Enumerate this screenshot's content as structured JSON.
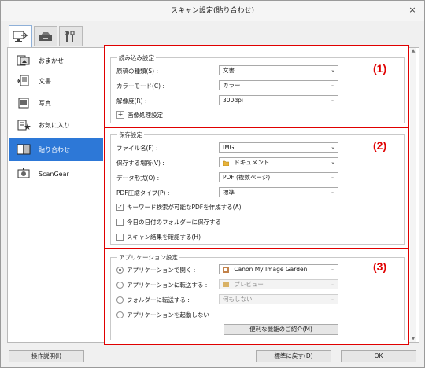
{
  "window": {
    "title": "スキャン設定(貼り合わせ)",
    "close_glyph": "×"
  },
  "tabs": [
    {
      "name": "scan-from-computer",
      "icon": "computer-scan-icon"
    },
    {
      "name": "scan-from-panel",
      "icon": "scanner-icon"
    },
    {
      "name": "general-settings",
      "icon": "tools-icon"
    }
  ],
  "sidebar": {
    "items": [
      {
        "label": "おまかせ",
        "icon": "auto-scan-icon"
      },
      {
        "label": "文書",
        "icon": "document-icon"
      },
      {
        "label": "写真",
        "icon": "photo-icon"
      },
      {
        "label": "お気に入り",
        "icon": "favorite-icon"
      },
      {
        "label": "貼り合わせ",
        "icon": "stitch-icon",
        "active": true
      },
      {
        "label": "ScanGear",
        "icon": "scangear-icon"
      }
    ]
  },
  "scan_options": {
    "title": "読み込み設定",
    "marker": "(1)",
    "source_label": "原稿の種類(S) :",
    "source_value": "文書",
    "color_mode_label": "カラーモード(C) :",
    "color_mode_value": "カラー",
    "resolution_label": "解像度(R) :",
    "resolution_value": "300dpi",
    "image_processing_label": "画像処理設定",
    "expand_glyph": "+"
  },
  "save_settings": {
    "title": "保存設定",
    "marker": "(2)",
    "file_name_label": "ファイル名(F) :",
    "file_name_value": "IMG",
    "save_in_label": "保存する場所(V) :",
    "save_in_value": "ドキュメント",
    "data_format_label": "データ形式(O) :",
    "data_format_value": "PDF (複数ページ)",
    "pdf_compression_label": "PDF圧縮タイプ(P) :",
    "pdf_compression_value": "標準",
    "keyword_pdf_label": "キーワード検索が可能なPDFを作成する(A)",
    "keyword_pdf_checked": true,
    "date_folder_label": "今日の日付のフォルダーに保存する",
    "date_folder_checked": false,
    "check_results_label": "スキャン結果を確認する(H)",
    "check_results_checked": false,
    "check_glyph": "✓"
  },
  "app_settings": {
    "title": "アプリケーション設定",
    "marker": "(3)",
    "open_with_app_label": "アプリケーションで開く :",
    "open_with_app_value": "Canon My Image Garden",
    "send_to_app_label": "アプリケーションに転送する :",
    "send_to_app_value": "プレビュー",
    "send_to_folder_label": "フォルダーに転送する :",
    "send_to_folder_value": "何もしない",
    "do_not_start_label": "アプリケーションを起動しない",
    "selected_option": "open_with_app",
    "more_functions_label": "便利な機能のご紹介(M)"
  },
  "footer": {
    "instructions_label": "操作説明(I)",
    "defaults_label": "標準に戻す(D)",
    "ok_label": "OK"
  },
  "glyphs": {
    "dropdown_arrow": "⌄",
    "scroll_up": "▲",
    "scroll_down": "▼"
  },
  "colors": {
    "highlight_border": "#e00000",
    "selected_item": "#2d78d7"
  }
}
